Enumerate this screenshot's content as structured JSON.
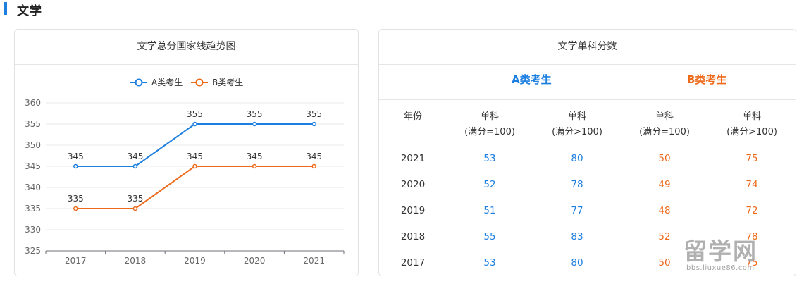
{
  "section": {
    "title": "文学",
    "accent": "#1c7fe0"
  },
  "colors": {
    "a": "#1c7fe0",
    "b": "#ee6a1b"
  },
  "chart_data": {
    "type": "line",
    "title": "文学总分国家线趋势图",
    "categories": [
      "2017",
      "2018",
      "2019",
      "2020",
      "2021"
    ],
    "series": [
      {
        "name": "A类考生",
        "values": [
          345,
          345,
          355,
          355,
          355
        ]
      },
      {
        "name": "B类考生",
        "values": [
          335,
          335,
          345,
          345,
          345
        ]
      }
    ],
    "ylim": [
      325,
      360
    ],
    "yticks": [
      325,
      330,
      335,
      340,
      345,
      350,
      355,
      360
    ],
    "grid": true,
    "legend": "top-center",
    "data_labels": true
  },
  "table": {
    "title": "文学单科分数",
    "groups": [
      "A类考生",
      "B类考生"
    ],
    "year_header": "年份",
    "col_headers": [
      {
        "line1": "单科",
        "line2": "(满分=100)"
      },
      {
        "line1": "单科",
        "line2": "(满分>100)"
      },
      {
        "line1": "单科",
        "line2": "(满分=100)"
      },
      {
        "line1": "单科",
        "line2": "(满分>100)"
      }
    ],
    "rows": [
      {
        "year": "2021",
        "a1": "53",
        "a2": "80",
        "b1": "50",
        "b2": "75"
      },
      {
        "year": "2020",
        "a1": "52",
        "a2": "78",
        "b1": "49",
        "b2": "74"
      },
      {
        "year": "2019",
        "a1": "51",
        "a2": "77",
        "b1": "48",
        "b2": "72"
      },
      {
        "year": "2018",
        "a1": "55",
        "a2": "83",
        "b1": "52",
        "b2": "78"
      },
      {
        "year": "2017",
        "a1": "53",
        "a2": "80",
        "b1": "50",
        "b2": "75"
      }
    ]
  },
  "watermark": {
    "main": "留学网",
    "sub": "bbs.liuxue86.com"
  }
}
